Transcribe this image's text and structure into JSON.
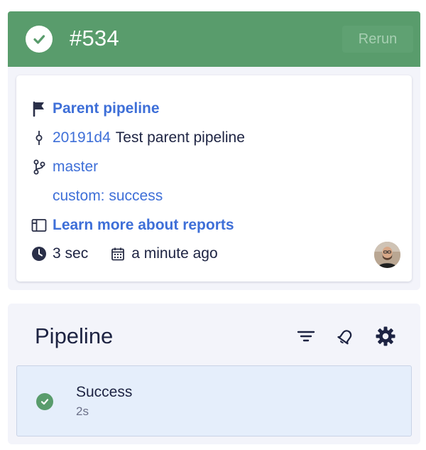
{
  "header": {
    "build_number": "#534",
    "status": "success",
    "rerun_label": "Rerun"
  },
  "info": {
    "parent_pipeline_label": "Parent pipeline",
    "commit": {
      "hash": "20191d4",
      "message": "Test parent pipeline"
    },
    "branch": "master",
    "custom_trigger": "custom: success",
    "reports_link": "Learn more about reports",
    "duration": "3 sec",
    "created": "a minute ago",
    "icons": [
      "flag-icon",
      "commit-icon",
      "branch-icon",
      "reports-icon",
      "clock-icon",
      "calendar-icon"
    ]
  },
  "pipeline": {
    "title": "Pipeline",
    "tools": [
      "filter-icon",
      "bell-icon",
      "gear-icon"
    ],
    "steps": [
      {
        "name": "Success",
        "duration": "2s",
        "status": "success"
      }
    ]
  },
  "colors": {
    "success_green": "#599c6c",
    "link_blue": "#3e6fd8",
    "text_dark": "#1d2342",
    "panel_bg": "#f3f4fa",
    "selected_row_bg": "#e5eefb"
  }
}
